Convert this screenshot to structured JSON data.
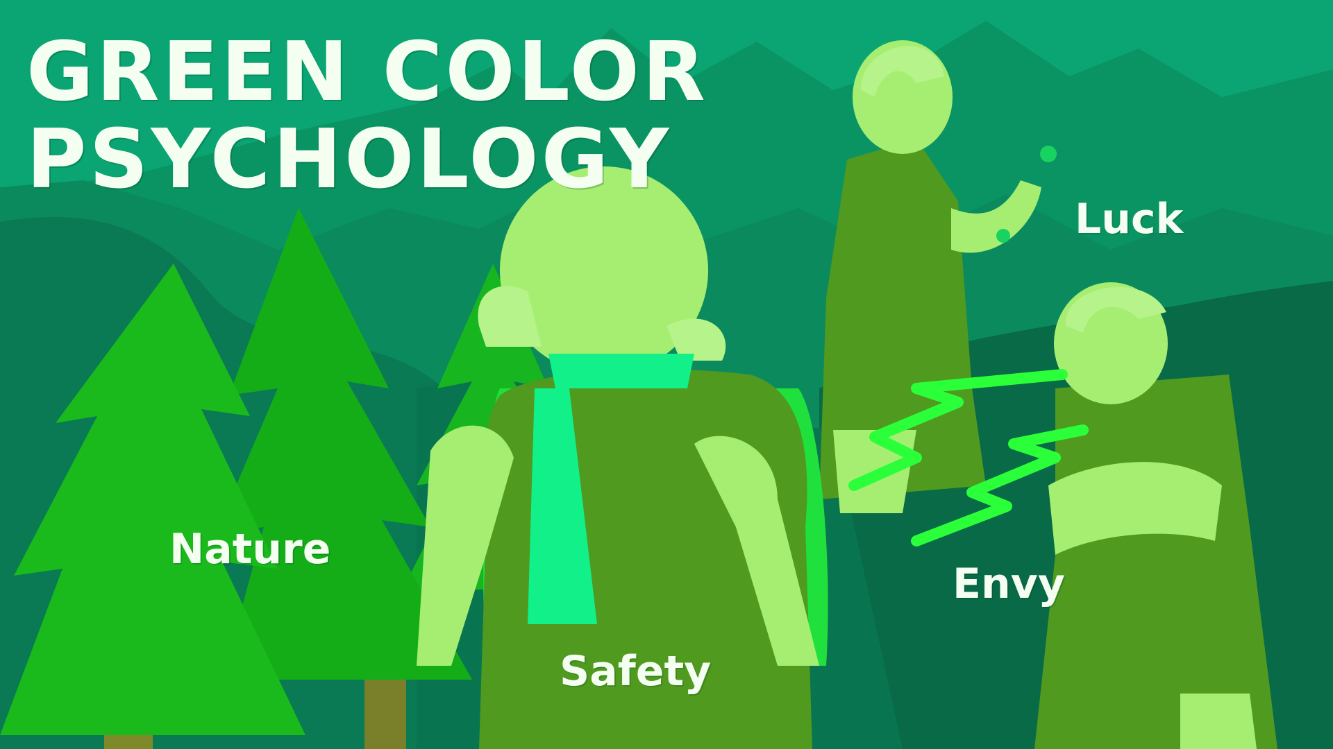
{
  "title": {
    "line1": "GREEN COLOR",
    "line2": "PSYCHOLOGY"
  },
  "labels": {
    "nature": "Nature",
    "safety": "Safety",
    "luck": "Luck",
    "envy": "Envy"
  },
  "colors": {
    "sky": "#0aa572",
    "mountain_mid": "#0b8a5d",
    "mountain_dark": "#096e4c",
    "tree": "#19b21b",
    "skin": "#a6ee72",
    "clothing": "#4f9a1f",
    "scarf": "#12f08a",
    "backpack": "#1fe03c",
    "zigzag": "#2aff3a",
    "text": "#f4fff2"
  }
}
